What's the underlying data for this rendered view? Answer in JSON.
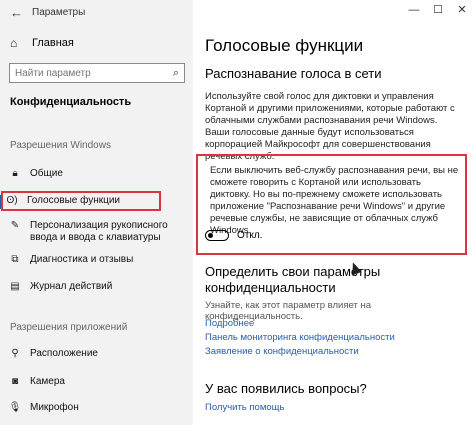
{
  "window": {
    "title": "Параметры",
    "minimize": "—",
    "maximize": "☐",
    "close": "✕"
  },
  "sidebar": {
    "home_label": "Главная",
    "search_placeholder": "Найти параметр",
    "section_title": "Конфиденциальность",
    "group_windows": "Разрешения Windows",
    "items_windows": [
      {
        "label": "Общие",
        "icon": "lock-icon"
      },
      {
        "label": "Голосовые функции",
        "icon": "speech-icon"
      },
      {
        "label": "Персонализация рукописного ввода и ввода с клавиатуры",
        "icon": "pen-icon"
      },
      {
        "label": "Диагностика и отзывы",
        "icon": "diagnostics-icon"
      },
      {
        "label": "Журнал действий",
        "icon": "activity-icon"
      }
    ],
    "group_apps": "Разрешения приложений",
    "items_apps": [
      {
        "label": "Расположение",
        "icon": "location-icon"
      },
      {
        "label": "Камера",
        "icon": "camera-icon"
      },
      {
        "label": "Микрофон",
        "icon": "microphone-icon"
      }
    ]
  },
  "main": {
    "title": "Голосовые функции",
    "section1_title": "Распознавание голоса в сети",
    "section1_text": "Используйте свой голос для диктовки и управления Кортаной и другими приложениями, которые работают с облачными службами распознавания речи Windows. Ваши голосовые данные будут использоваться корпорацией Майкрософт для совершенствования речевых служб.",
    "callout_text": "Если выключить веб-службу распознавания речи, вы не сможете говорить с Кортаной или использовать диктовку. Но вы по-прежнему сможете использовать приложение \"Распознавание речи Windows\" и другие речевые службы, не зависящие от облачных служб Windows.",
    "toggle_state_label": "Откл.",
    "toggle_on": false,
    "section2_title": "Определить свои параметры конфиденциальности",
    "section2_text": "Узнайте, как этот параметр влияет на конфиденциальность.",
    "links": [
      "Подробнее",
      "Панель мониторинга конфиденциальности",
      "Заявление о конфиденциальности"
    ],
    "section3_title": "У вас появились вопросы?",
    "help_link": "Получить помощь"
  },
  "colors": {
    "highlight": "#d9363e",
    "link": "#2a5da8",
    "accent": "#1f5fa8"
  }
}
